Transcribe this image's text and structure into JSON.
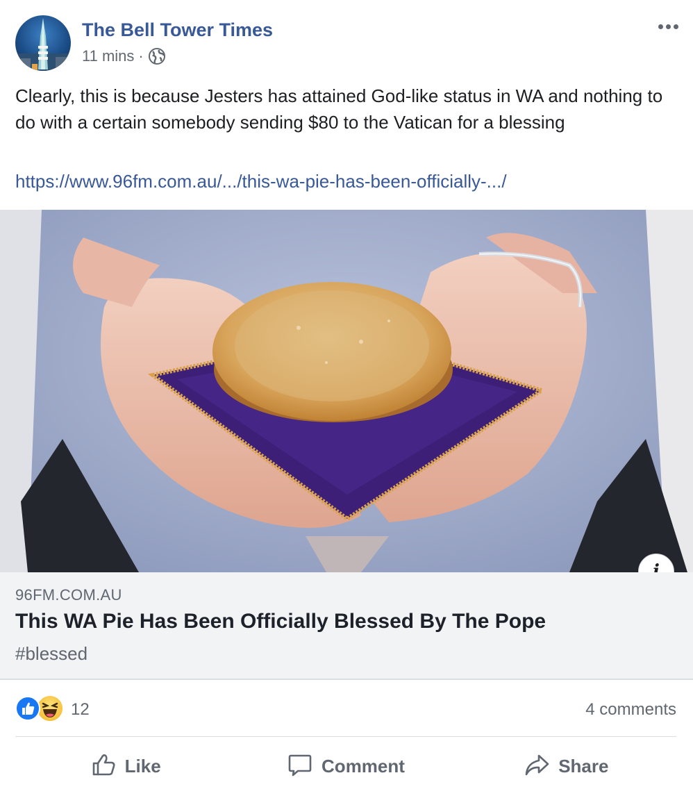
{
  "post": {
    "page_name": "The Bell Tower Times",
    "timestamp": "11 mins",
    "separator": "·",
    "privacy_icon": "globe-icon",
    "more_icon": "more-options-icon",
    "text": "Clearly, this is because Jesters has attained God-like status in WA and nothing to do with a certain somebody sending $80 to the Vatican for a blessing",
    "link_text": "https://www.96fm.com.au/.../this-wa-pie-has-been-officially-.../"
  },
  "link_preview": {
    "image_icon": "pie-on-cushion-photo",
    "info_icon": "info-icon",
    "info_label": "i",
    "domain": "96FM.COM.AU",
    "title": "This WA Pie Has Been Officially Blessed By The Pope",
    "description": "#blessed"
  },
  "engagement": {
    "reactions": [
      "like",
      "haha"
    ],
    "reaction_count": "12",
    "comments": "4 comments"
  },
  "actions": {
    "like": "Like",
    "comment": "Comment",
    "share": "Share"
  },
  "colors": {
    "link": "#385898",
    "like_blue": "#1877f2",
    "secondary_text": "#606770",
    "card_bg": "#f2f3f5"
  }
}
